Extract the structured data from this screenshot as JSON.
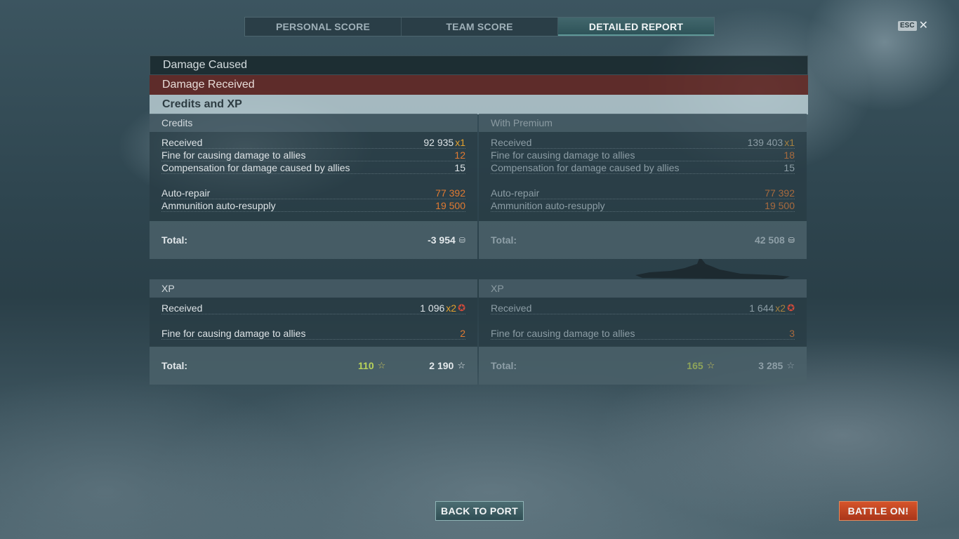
{
  "tabs": [
    {
      "label": "PERSONAL SCORE"
    },
    {
      "label": "TEAM SCORE"
    },
    {
      "label": "DETAILED REPORT",
      "active": true
    }
  ],
  "esc": {
    "key": "ESC",
    "close": "✕"
  },
  "sections": {
    "damage_caused": "Damage Caused",
    "damage_received": "Damage Received",
    "credits_xp": "Credits and XP"
  },
  "credits": {
    "header": "Credits",
    "received_label": "Received",
    "received_value": "92 935",
    "received_mult": "x1",
    "fine_label": "Fine for causing damage to allies",
    "fine_value": "12",
    "comp_label": "Compensation for damage caused by allies",
    "comp_value": "15",
    "repair_label": "Auto-repair",
    "repair_value": "77 392",
    "ammo_label": "Ammunition auto-resupply",
    "ammo_value": "19 500",
    "total_label": "Total:",
    "total_value": "-3 954"
  },
  "credits_premium": {
    "header": "With Premium",
    "received_label": "Received",
    "received_value": "139 403",
    "received_mult": "x1",
    "fine_label": "Fine for causing damage to allies",
    "fine_value": "18",
    "comp_label": "Compensation for damage caused by allies",
    "comp_value": "15",
    "repair_label": "Auto-repair",
    "repair_value": "77 392",
    "ammo_label": "Ammunition auto-resupply",
    "ammo_value": "19 500",
    "total_label": "Total:",
    "total_value": "42 508"
  },
  "xp": {
    "header": "XP",
    "received_label": "Received",
    "received_value": "1 096",
    "received_mult": "x2",
    "fine_label": "Fine for causing damage to allies",
    "fine_value": "2",
    "total_label": "Total:",
    "total_free": "110",
    "total_value": "2 190"
  },
  "xp_premium": {
    "header": "XP",
    "received_label": "Received",
    "received_value": "1 644",
    "received_mult": "x2",
    "fine_label": "Fine for causing damage to allies",
    "fine_value": "3",
    "total_label": "Total:",
    "total_free": "165",
    "total_value": "3 285"
  },
  "buttons": {
    "back": "BACK TO PORT",
    "battle": "BATTLE ON!"
  },
  "icons": {
    "credit": "credit-coin-icon",
    "star": "star-icon",
    "xp_star_red": "premium-star-icon",
    "close": "close-icon"
  }
}
